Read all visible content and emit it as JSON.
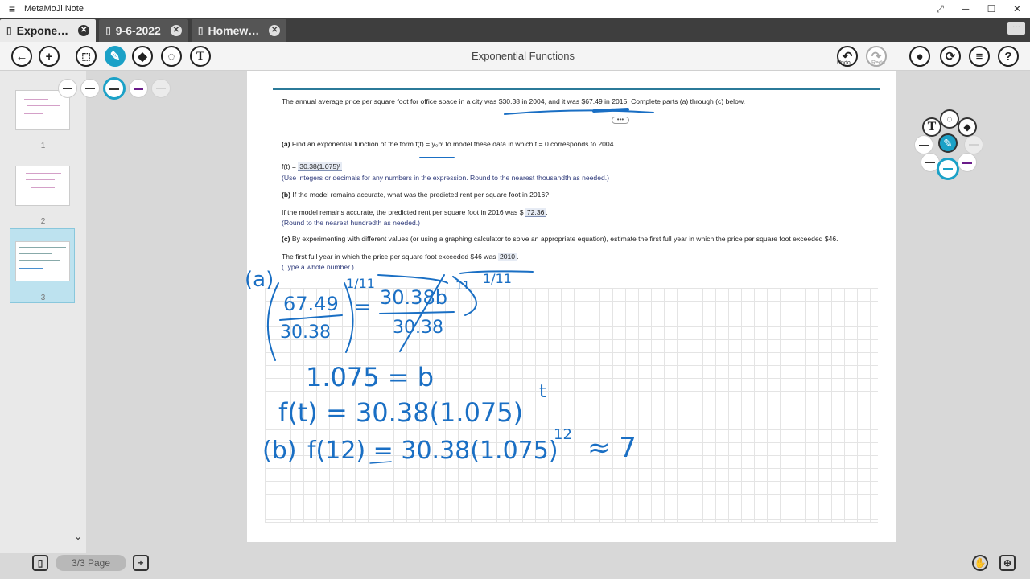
{
  "app": {
    "title": "MetaMoJi Note",
    "menu_icon": "hamburger-icon",
    "window_buttons": [
      "⤢",
      "─",
      "☐",
      "✕"
    ]
  },
  "tabs": [
    {
      "label": "Expone…",
      "active": true
    },
    {
      "label": "9-6-2022",
      "active": false
    },
    {
      "label": "Homew…",
      "active": false
    }
  ],
  "tabbar": {
    "more_label": "···"
  },
  "toolbar": {
    "document_title": "Exponential Functions",
    "undo_label": "Undo",
    "redo_label": "Redo",
    "accent_color": "#1ba1c7"
  },
  "sidebar": {
    "pages": [
      {
        "number": "1"
      },
      {
        "number": "2"
      },
      {
        "number": "3",
        "selected": true
      }
    ]
  },
  "bottombar": {
    "page_indicator": "3/3 Page"
  },
  "problem": {
    "intro": "The annual average price per square foot for office space in a city was $30.38 in 2004, and it was $67.49 in 2015. Complete parts (a) through (c) below.",
    "part_a": {
      "label": "(a)",
      "question": "Find an exponential function of the form f(t) = y₀bᵗ to model these data in which t = 0 corresponds to 2004.",
      "answer_prefix": "f(t) =",
      "answer": "30.38(1.075)ᵗ",
      "note": "(Use integers or decimals for any numbers in the expression. Round to the nearest thousandth as needed.)"
    },
    "part_b": {
      "label": "(b)",
      "question": "If the model remains accurate, what was the predicted rent per square foot in 2016?",
      "answer_prefix": "If the model remains accurate, the predicted rent per square foot in 2016 was $",
      "answer": "72.36",
      "answer_suffix": ".",
      "note": "(Round to the nearest hundredth as needed.)"
    },
    "part_c": {
      "label": "(c)",
      "question": "By experimenting with different values (or using a graphing calculator to solve an appropriate equation), estimate the first full year in which the price per square foot exceeded $46.",
      "answer_prefix": "The first full year in which the price per square foot exceeded $46 was",
      "answer": "2010",
      "answer_suffix": ".",
      "note": "(Type a whole number.)"
    }
  },
  "handwriting": {
    "ink_color": "#1a6fc4",
    "line_a_label": "(a)",
    "line1": "(67.49 / 30.38)^(1/11) = (30.38 b^11 / 30.38)^(1/11)",
    "line2": "1.075 = b",
    "line3": "f(t) = 30.38(1.075)",
    "line3_sup": "t",
    "line4_label": "(b)",
    "line4": "f(12) = 30.38(1.075)",
    "line4_sup": "12",
    "line4_tail": "≈ 7"
  }
}
